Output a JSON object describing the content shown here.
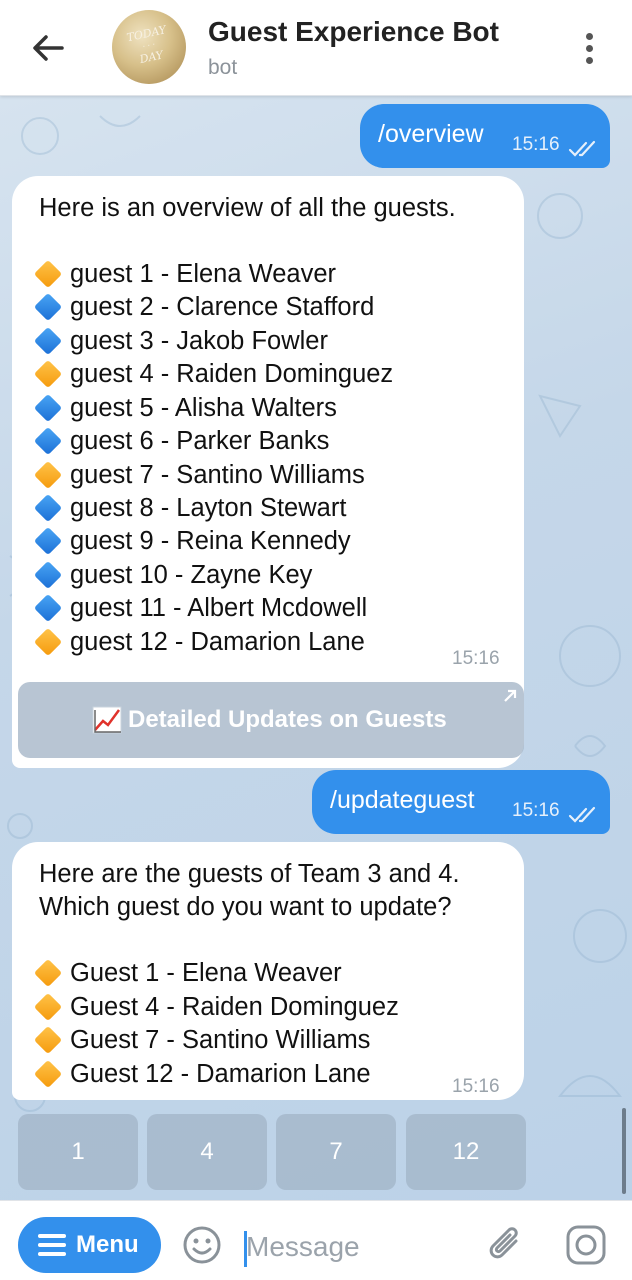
{
  "header": {
    "title": "Guest Experience Bot",
    "subtitle": "bot",
    "avatar_text": [
      "TODAY",
      "DAY"
    ]
  },
  "messages": [
    {
      "type": "out",
      "text": "/overview",
      "time": "15:16"
    },
    {
      "type": "in",
      "intro": "Here is an overview of all the guests.",
      "time": "15:16",
      "lines": [
        {
          "icon": "orange-diamond-icon",
          "text": "guest 1 - Elena Weaver"
        },
        {
          "icon": "blue-diamond-icon",
          "text": "guest 2 - Clarence Stafford"
        },
        {
          "icon": "blue-diamond-icon",
          "text": "guest 3 - Jakob Fowler"
        },
        {
          "icon": "orange-diamond-icon",
          "text": "guest 4 - Raiden Dominguez"
        },
        {
          "icon": "blue-diamond-icon",
          "text": "guest 5 - Alisha Walters"
        },
        {
          "icon": "blue-diamond-icon",
          "text": "guest 6 - Parker Banks"
        },
        {
          "icon": "orange-diamond-icon",
          "text": "guest 7 - Santino Williams"
        },
        {
          "icon": "blue-diamond-icon",
          "text": "guest 8 - Layton Stewart"
        },
        {
          "icon": "blue-diamond-icon",
          "text": "guest 9 - Reina Kennedy"
        },
        {
          "icon": "blue-diamond-icon",
          "text": "guest 10 - Zayne Key"
        },
        {
          "icon": "blue-diamond-icon",
          "text": "guest 11 - Albert Mcdowell"
        },
        {
          "icon": "orange-diamond-icon",
          "text": "guest 12 - Damarion Lane"
        }
      ]
    },
    {
      "type": "inline_button",
      "icon": "chart-increasing-icon",
      "label": "Detailed Updates on Guests"
    },
    {
      "type": "out",
      "text": "/updateguest",
      "time": "15:16"
    },
    {
      "type": "in",
      "intro1": "Here are the guests of Team 3 and 4.",
      "intro2": "Which guest do you want to update?",
      "time": "15:16",
      "lines": [
        {
          "icon": "orange-diamond-icon",
          "text": "Guest 1 - Elena Weaver"
        },
        {
          "icon": "orange-diamond-icon",
          "text": "Guest 4 - Raiden Dominguez"
        },
        {
          "icon": "orange-diamond-icon",
          "text": "Guest 7 - Santino Williams"
        },
        {
          "icon": "orange-diamond-icon",
          "text": "Guest 12 - Damarion Lane"
        }
      ]
    }
  ],
  "keyboard": [
    "1",
    "4",
    "7",
    "12"
  ],
  "composer": {
    "menu_label": "Menu",
    "placeholder": "Message"
  },
  "colors": {
    "accent": "#3390ec",
    "orange_diamond": "#f5a623",
    "blue_diamond": "#2f86e8"
  }
}
